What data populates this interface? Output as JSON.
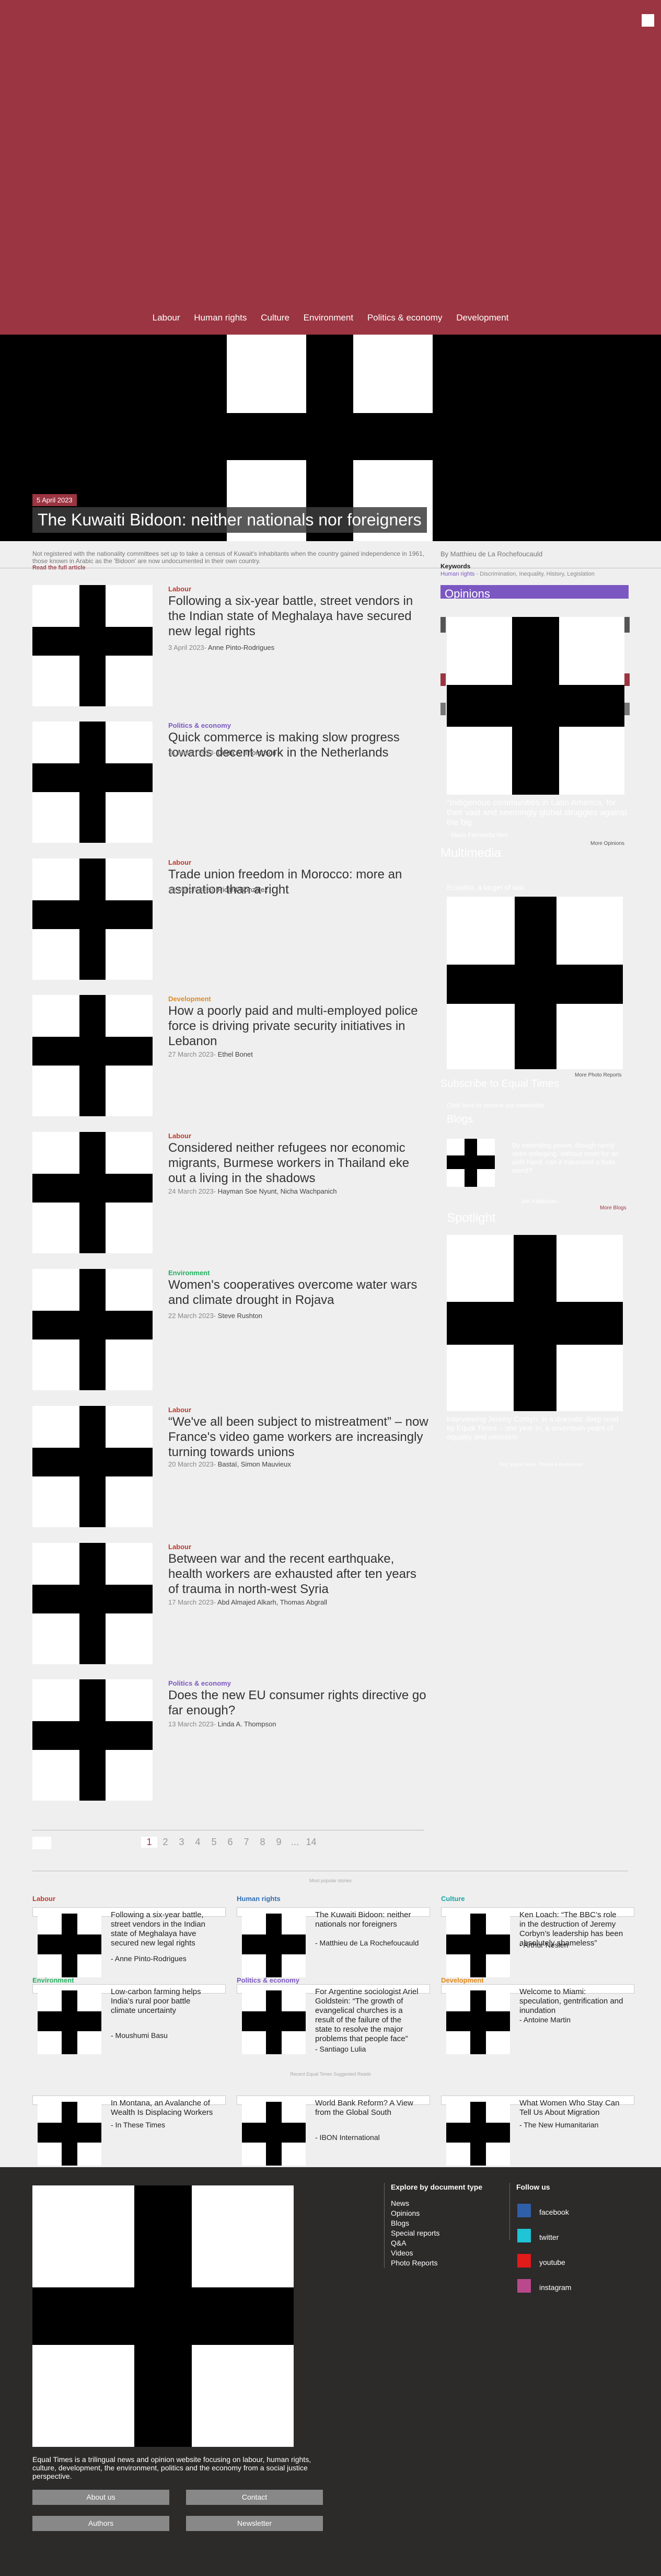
{
  "nav": [
    "Labour",
    "Human rights",
    "Culture",
    "Environment",
    "Politics & economy",
    "Development"
  ],
  "hero": {
    "date": "5 April 2023",
    "title": "The Kuwaiti Bidoon: neither nationals nor foreigners",
    "excerpt": "Not registered with the nationality committees set up to take a census of Kuwait's inhabitants when the country gained independence in 1961, those known in Arabic as the 'Bidoon' are now undocumented in their own country.",
    "read_full": "Read the full article",
    "byline": "By Matthieu de La Rochefoucauld",
    "keywords_label": "Keywords",
    "keywords_main": "Human rights",
    "keywords_rest": " - Discrimination, Inequality, History, Legislation"
  },
  "articles": [
    {
      "cat": "Labour",
      "color": "#c0392b",
      "title": "Following a six-year battle, street vendors in the Indian state of Meghalaya have secured new legal rights",
      "date": "3 April 2023-",
      "author": "Anne Pinto-Rodrigues"
    },
    {
      "cat": "Politics & economy",
      "color": "#7b57c2",
      "title": "Quick commerce is making slow progress towards decent work in the Netherlands",
      "date": "31 March 2023-",
      "author": "Linda A. Thompson"
    },
    {
      "cat": "Labour",
      "color": "#c0392b",
      "title": "Trade union freedom in Morocco: more an aspiration than a right",
      "date": "29 March 2023-",
      "author": "Ricard González"
    },
    {
      "cat": "Development",
      "color": "#e08a1e",
      "title": "How a poorly paid and multi-employed police force is driving private security initiatives in Lebanon",
      "date": "27 March 2023-",
      "author": "Ethel Bonet"
    },
    {
      "cat": "Labour",
      "color": "#c0392b",
      "title": "Considered neither refugees nor economic migrants, Burmese workers in Thailand eke out a living in the shadows",
      "date": "24 March 2023-",
      "author": "Hayman Soe Nyunt, Nicha Wachpanich"
    },
    {
      "cat": "Environment",
      "color": "#27ae60",
      "title": "Women's cooperatives overcome water wars and climate drought in Rojava",
      "date": "22 March 2023-",
      "author": "Steve Rushton"
    },
    {
      "cat": "Labour",
      "color": "#c0392b",
      "title": "“We've all been subject to mistreatment” – now France's video game workers are increasingly turning towards unions",
      "date": "20 March 2023-",
      "author": "Bastaï, Simon Mauvieux"
    },
    {
      "cat": "Labour",
      "color": "#c0392b",
      "title": "Between war and the recent earthquake, health workers are exhausted after ten years of trauma in north-west Syria",
      "date": "17 March 2023-",
      "author": "Abd Almajed Alkarh, Thomas Abgrall"
    },
    {
      "cat": "Politics & economy",
      "color": "#7b57c2",
      "title": "Does the new EU consumer rights directive go far enough?",
      "date": "13 March 2023-",
      "author": "Linda A. Thompson"
    }
  ],
  "pager": [
    "1",
    "2",
    "3",
    "4",
    "5",
    "6",
    "7",
    "8",
    "9",
    "...",
    "14"
  ],
  "sidebar": {
    "opinions": "Opinions",
    "opinion_text": "“Indigenous communities in Latin America, for their vast and seemingly global struggles against the big",
    "opinion_author": "- Maria Fernanda Neri",
    "more_opinions": "More Opinions",
    "multimedia": "Multimedia",
    "photo_caption": "Ecuador, a target of war",
    "more_photo": "More Photo Reports",
    "subscribe": "Subscribe to Equal Times",
    "subscribe_note": "Click here to receive our newsletter",
    "blogs": "Blogs",
    "blog_text": "By extending power, though rarely seen enlarging, without room for an unfit hand, can it transcend a finite world?",
    "blog_author": "- Jon Kasbarian",
    "more_blogs": "More Blogs",
    "spotlight": "Spotlight",
    "spotlight_text": "Interviewing Jeremy Corbyn: in a dramatic deep read by Equal Times – one year in, a seventeen years of equality and unionism",
    "spotlight_author": "Text: Equal Times, Photos & illustrations"
  },
  "most_read_label": "Most popular stories",
  "recent_label": "Recent Equal Times   Suggested Reads",
  "grid": [
    {
      "cat": "Labour",
      "color": "#c0392b",
      "title": "Following a six-year battle, street vendors in the Indian state of Meghalaya have secured new legal rights",
      "author": "- Anne Pinto-Rodrigues"
    },
    {
      "cat": "Human rights",
      "color": "#2f6fb5",
      "title": "The Kuwaiti Bidoon: neither nationals nor foreigners",
      "author": "- Matthieu de La Rochefoucauld"
    },
    {
      "cat": "Culture",
      "color": "#17a5a5",
      "title": "Ken Loach: “The BBC’s role in the destruction of Jeremy Corbyn’s leadership has been absolutely shameless”",
      "author": "- Arthur Neslen"
    },
    {
      "cat": "Environment",
      "color": "#27ae60",
      "title": "Low-carbon farming helps India’s rural poor battle climate uncertainty",
      "author": "- Moushumi Basu"
    },
    {
      "cat": "Politics & economy",
      "color": "#7b57c2",
      "title": "For Argentine sociologist Ariel Goldstein: “The growth of evangelical churches is a result of the failure of the state to resolve the major problems that people face”",
      "author": "- Santiago Lulia"
    },
    {
      "cat": "Development",
      "color": "#e08a1e",
      "title": "Welcome to Miami: speculation, gentrification and inundation",
      "author": "- Antoine Martin"
    },
    {
      "cat": "",
      "color": "#333",
      "title": "In Montana, an Avalanche of Wealth Is Displacing Workers",
      "author": "- In These Times"
    },
    {
      "cat": "",
      "color": "#333",
      "title": "World Bank Reform? A View from the Global South",
      "author": "- IBON International"
    },
    {
      "cat": "",
      "color": "#333",
      "title": "What Women Who Stay Can Tell Us About Migration",
      "author": "- The New Humanitarian"
    }
  ],
  "footer": {
    "explore_title": "Explore by document type",
    "explore": [
      "News",
      "Opinions",
      "Blogs",
      "Special reports",
      "Q&A",
      "Videos",
      "Photo Reports"
    ],
    "follow_title": "Follow us",
    "social": [
      {
        "label": "facebook",
        "color": "#2f5fa8"
      },
      {
        "label": "twitter",
        "color": "#1fc4d6"
      },
      {
        "label": "youtube",
        "color": "#e11a1a"
      },
      {
        "label": "instagram",
        "color": "#b9498c"
      }
    ],
    "about": "Equal Times is a trilingual news and opinion website focusing on labour, human rights, culture, development, the environment, politics and the economy from a social justice perspective.",
    "buttons": [
      "About us",
      "Contact",
      "Authors",
      "Newsletter"
    ]
  }
}
